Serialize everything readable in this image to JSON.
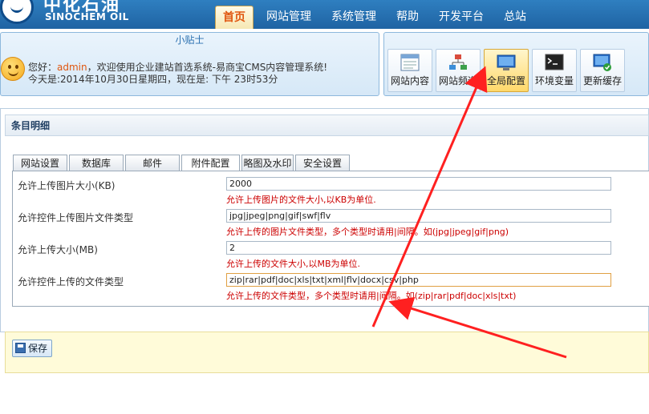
{
  "header": {
    "logo_cn": "中化石油",
    "logo_en": "SINOCHEM OIL",
    "nav": [
      "首页",
      "网站管理",
      "系统管理",
      "帮助",
      "开发平台",
      "总站"
    ],
    "active_nav": "首页"
  },
  "tips": {
    "title": "小贴士",
    "greeting_prefix": "您好：",
    "user": "admin",
    "greeting_suffix": "，欢迎使用企业建站首选系统-易商宝CMS内容管理系统!",
    "today": "今天是:2014年10月30日星期四，现在是: 下午 23时53分"
  },
  "quick": {
    "buttons": [
      {
        "label": "网站内容",
        "icon": "site-content-icon"
      },
      {
        "label": "网站频道",
        "icon": "site-channel-icon"
      },
      {
        "label": "全局配置",
        "icon": "global-config-icon"
      },
      {
        "label": "环境变量",
        "icon": "env-variable-icon"
      },
      {
        "label": "更新缓存",
        "icon": "refresh-cache-icon"
      }
    ],
    "active": "全局配置"
  },
  "panel": {
    "title": "条目明细"
  },
  "tabs": [
    "网站设置",
    "数据库",
    "邮件",
    "附件配置",
    "略图及水印",
    "安全设置"
  ],
  "active_tab": "附件配置",
  "form": {
    "fields": [
      {
        "label": "允许上传图片大小(KB)",
        "value": "2000",
        "hint": "允许上传图片的文件大小,以KB为单位."
      },
      {
        "label": "允许控件上传图片文件类型",
        "value": "jpg|jpeg|png|gif|swf|flv",
        "hint": "允许上传的图片文件类型，多个类型时请用|间隔。如(jpg|jpeg|gif|png)"
      },
      {
        "label": "允许上传大小(MB)",
        "value": "2",
        "hint": "允许上传的文件大小,以MB为单位."
      },
      {
        "label": "允许控件上传的文件类型",
        "value": "zip|rar|pdf|doc|xls|txt|xml|flv|docx|csv|php",
        "hint": "允许上传的文件类型，多个类型时请用|间隔。如(zip|rar|pdf|doc|xls|txt)"
      }
    ]
  },
  "save": {
    "label": "保存"
  },
  "colors": {
    "accent": "#e0560f",
    "hint": "#cc0000",
    "annotation_arrow": "#ff2020"
  }
}
